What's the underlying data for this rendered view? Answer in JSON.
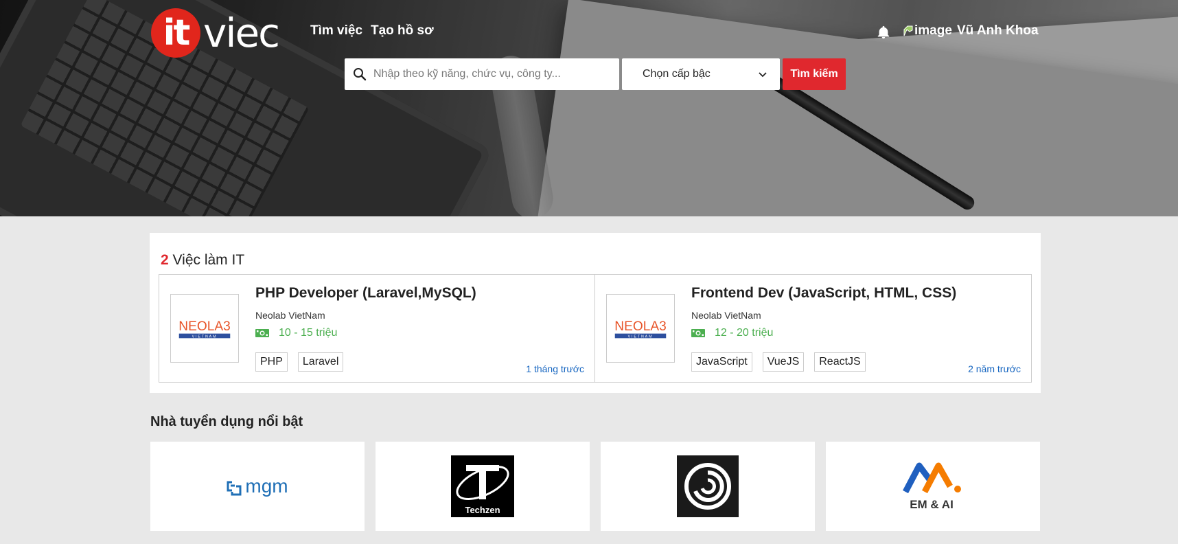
{
  "header": {
    "logo_it": "it",
    "logo_viec": "viec",
    "nav": [
      {
        "label": "Tìm việc"
      },
      {
        "label": "Tạo hồ sơ"
      }
    ],
    "avatar_alt": "image",
    "username": "Vũ Anh Khoa"
  },
  "search": {
    "placeholder": "Nhập theo kỹ năng, chức vụ, công ty...",
    "level_label": "Chọn cấp bậc",
    "button_label": "Tìm kiếm"
  },
  "jobs": {
    "count": "2",
    "heading": "Việc làm IT",
    "items": [
      {
        "title": "PHP Developer (Laravel,MySQL)",
        "company": "Neolab VietNam",
        "salary": "10 - 15 triệu",
        "tags": [
          "PHP",
          "Laravel"
        ],
        "posted": "1 tháng trước",
        "logo_text": "NEOLA3",
        "logo_sub": "VIETNAM"
      },
      {
        "title": "Frontend Dev (JavaScript, HTML, CSS)",
        "company": "Neolab VietNam",
        "salary": "12 - 20 triệu",
        "tags": [
          "JavaScript",
          "VueJS",
          "ReactJS"
        ],
        "posted": "2 năm trước",
        "logo_text": "NEOLA3",
        "logo_sub": "VIETNAM"
      }
    ]
  },
  "employers": {
    "heading": "Nhà tuyển dụng nổi bật",
    "items": [
      {
        "logo_text": "mgm"
      },
      {
        "logo_text": "Techzen"
      },
      {
        "icon": "ubisoft-swirl-logo"
      },
      {
        "logo_text": "EM & AI"
      }
    ]
  },
  "colors": {
    "brand_red": "#e1261c",
    "search_button": "#e0282e",
    "salary_green": "#4caf50",
    "posted_blue": "#1565c0"
  }
}
